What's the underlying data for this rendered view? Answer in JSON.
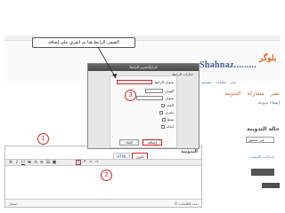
{
  "topbar": {
    "right_text": ""
  },
  "header": {
    "blog_title": ".....Shahnaz.........",
    "logo_text": "بلوگر",
    "nav_items": [
      "نشر",
      "تعليقات",
      "تصميم",
      "إعدادات",
      "إحصاءات"
    ]
  },
  "post": {
    "tabs": [
      "التدوينة",
      "مشاركة",
      "نشر"
    ],
    "new_post_link": "إنشاء تدوينة"
  },
  "side": {
    "title": "حالة التدوينة",
    "select_value": "غير منشور",
    "links": [
      "إعدادات التدوينة"
    ]
  },
  "callout": {
    "text": "الصقي الرابط هنا ثم انقري على إضافة"
  },
  "dialog": {
    "title": "إدراج/تحرير الرابط",
    "section_title": "خيارات الرابط",
    "url_label": "عنوان الرابط",
    "rows": [
      "الهدف",
      "عنوان",
      "الفئة",
      "معرف",
      "نمط",
      "اتجاه"
    ],
    "buttons": {
      "insert": "إضافة",
      "cancel": "إلغاء"
    }
  },
  "editor": {
    "label": "التدوينة",
    "modes": {
      "compose": "تكوين",
      "html": "HTML",
      "preview": "معاينة"
    },
    "status_left": "مسار:",
    "status_right": "عدد الكلمات: 0"
  },
  "markers": [
    "1",
    "2",
    "3"
  ],
  "colors": {
    "accent_red": "#d92020",
    "link_blue": "#4473b8",
    "brand_orange": "#e0641b"
  }
}
